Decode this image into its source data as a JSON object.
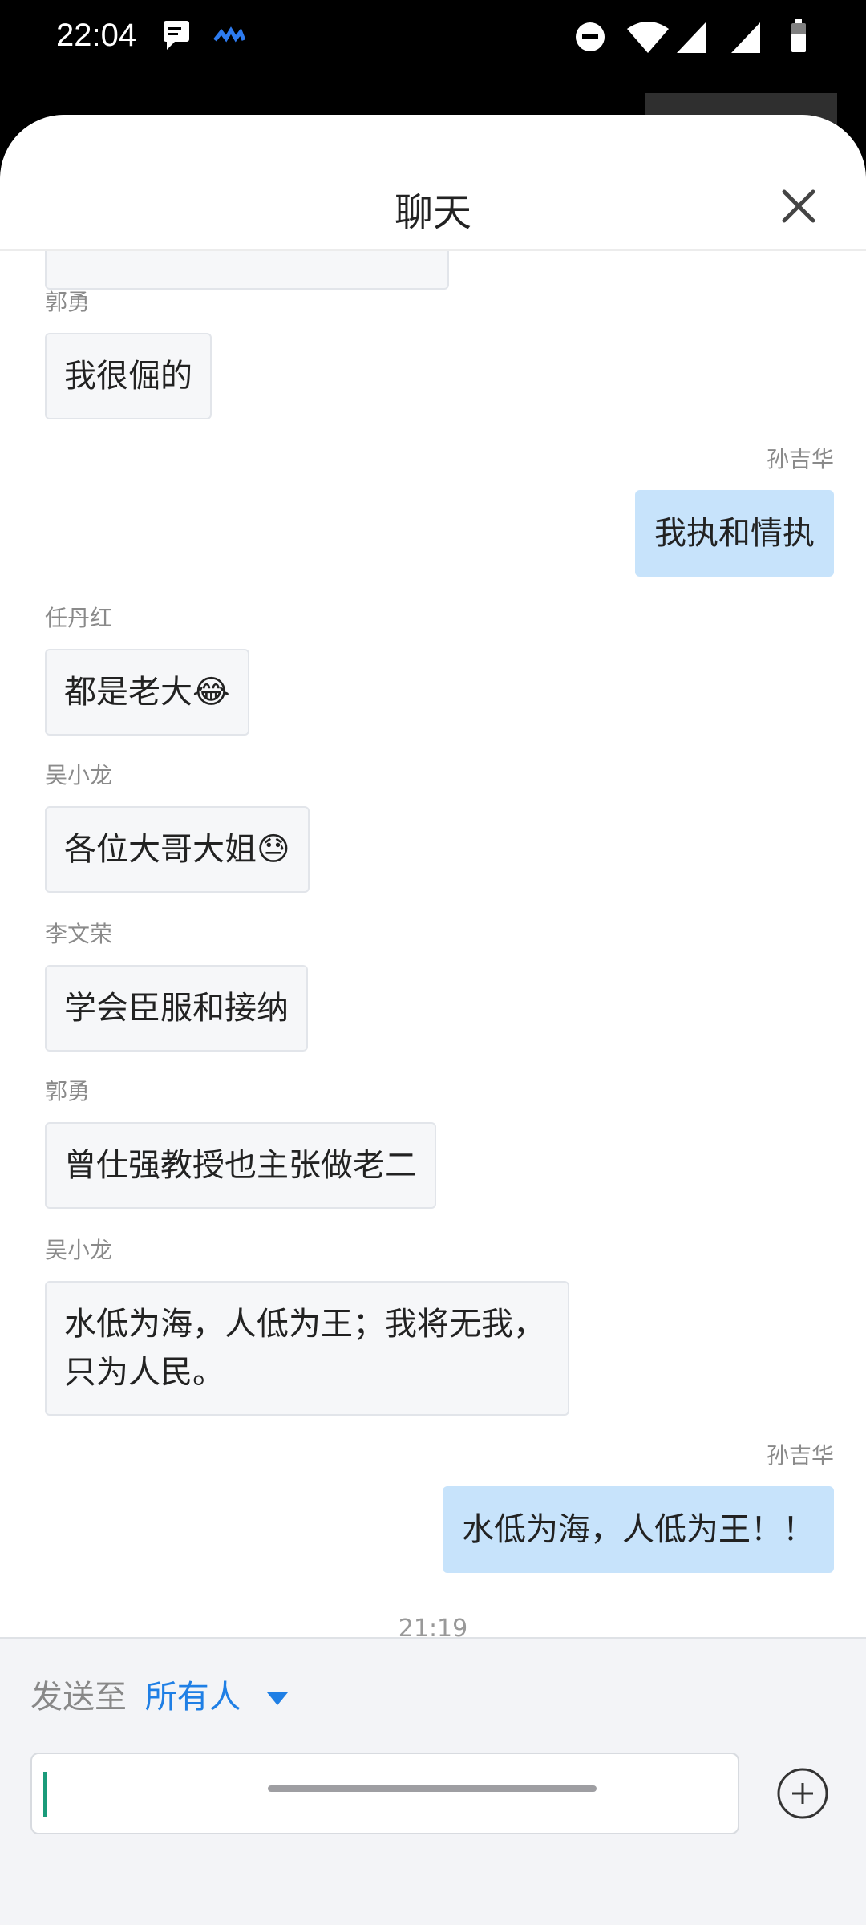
{
  "status_bar": {
    "time": "22:04",
    "icons": [
      "message-icon",
      "cloud-icon",
      "do-not-disturb-icon",
      "wifi-icon",
      "signal-icon",
      "signal-icon",
      "battery-icon"
    ]
  },
  "header": {
    "title": "聊天",
    "close_icon": "close-icon"
  },
  "messages": [
    {
      "sender": "郭勇",
      "text": "我很倔的"
    },
    {
      "sender": "孙吉华",
      "text": "我执和情执"
    },
    {
      "sender": "任丹红",
      "text": "都是老大😂"
    },
    {
      "sender": "吴小龙",
      "text": "各位大哥大姐😓"
    },
    {
      "sender": "李文荣",
      "text": "学会臣服和接纳"
    },
    {
      "sender": "郭勇",
      "text": "曾仕强教授也主张做老二"
    },
    {
      "sender": "吴小龙",
      "text": "水低为海，人低为王；我将无我，只为人民。"
    },
    {
      "sender": "孙吉华",
      "text": "水低为海，人低为王！！"
    }
  ],
  "timestamp": "21:19",
  "compose": {
    "send_to_label": "发送至",
    "send_to_target": "所有人",
    "input_value": "",
    "add_icon": "plus-circle-icon"
  },
  "colors": {
    "accent": "#1f7fe5",
    "mine_bubble": "#c7e3fb",
    "other_bubble": "#f6f7f9"
  }
}
